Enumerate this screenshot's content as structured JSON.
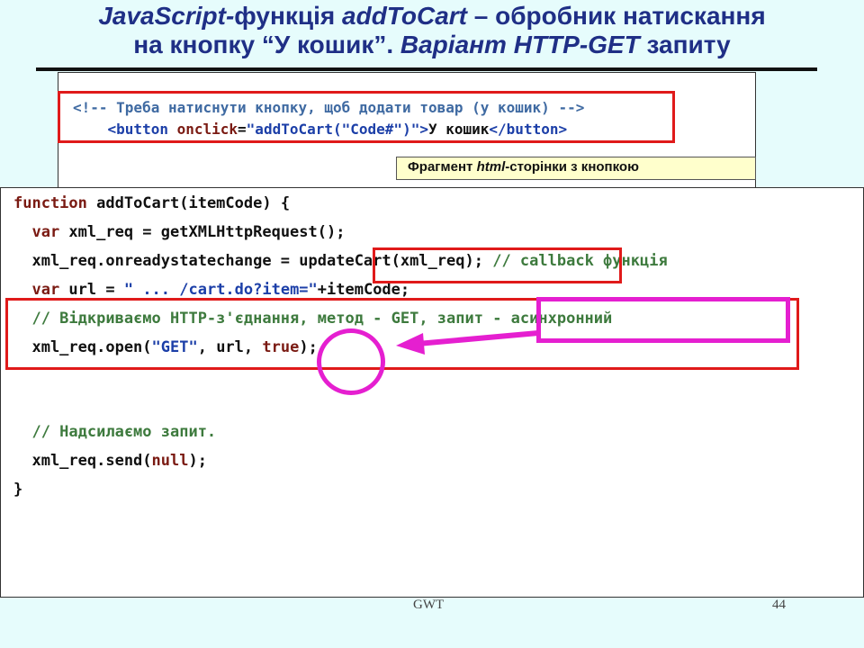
{
  "title": {
    "line1_italic_a": "JavaScript-",
    "line1_regular": "функція ",
    "line1_italic_b": "addToCart",
    "line1_rest": " – обробник натискання",
    "line2_regular": "на кнопку “У кошик”. ",
    "line2_italic": "Варіант HTTP-GET",
    "line2_rest": " запиту"
  },
  "html_fragment": {
    "comment": "<!-- Треба натиснути кнопку, щоб додати товар (у кошик) -->",
    "tag_open": "<button",
    "attr": " onclick",
    "eq": "=",
    "value": "\"addToCart(\"Code#\")\"",
    "close_bracket": ">",
    "text": "У кошик",
    "tag_close": "</button>"
  },
  "caption": {
    "prefix": "Фрагмент ",
    "italic": "html",
    "suffix": "-сторінки з кнопкою"
  },
  "code": {
    "l1_kw": "function",
    "l1_rest": " addToCart(itemCode) {",
    "l2_kw": "  var",
    "l2_rest": " xml_req = getXMLHttpRequest();",
    "l3_code": "  xml_req.onreadystatechange = updateCart(xml_req);",
    "l3_comment": " // callback функція",
    "l4_kw": "  var",
    "l4_mid": " url = ",
    "l4_str": "\" ... /cart.do?item=\"",
    "l4_rest": "+itemCode;",
    "l5_comment": "  // Відкриваємо HTTP-з'єднання, метод - GET, запит - асинхронний",
    "l6_pre": "  xml_req.open(",
    "l6_str": "\"GET\"",
    "l6_mid": ", url, ",
    "l6_kw": "true",
    "l6_rest": ");",
    "l7_comment": "  // Надсилаємо запит.",
    "l8_pre": "  xml_req.send(",
    "l8_kw": "null",
    "l8_rest": ");",
    "l9": "}"
  },
  "footer": {
    "left": "GWT",
    "page_number": "44"
  },
  "colors": {
    "background": "#e6fcfc",
    "title": "#1f2f86",
    "highlight_red": "#e01a1a",
    "highlight_magenta": "#e51fd0"
  }
}
